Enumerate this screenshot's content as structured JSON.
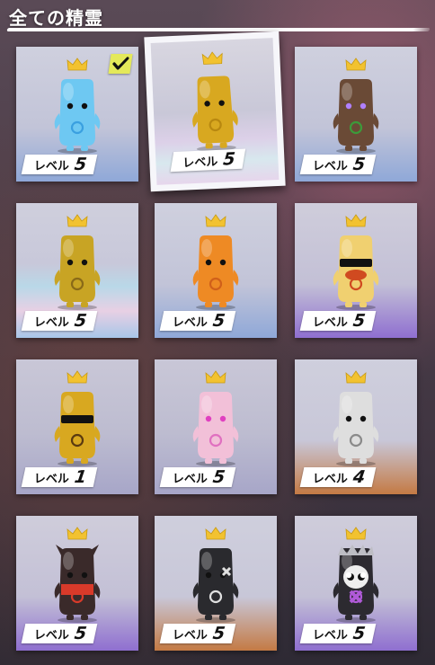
{
  "header": {
    "title": "全ての精霊"
  },
  "level_label": "レベル",
  "spirits": [
    {
      "level": "5",
      "body": "#6ec8f2",
      "accent": "#3aa0e0",
      "bg": "blue",
      "owned": true,
      "selected": false
    },
    {
      "level": "5",
      "body": "#d8a820",
      "accent": "#b88810",
      "bg": "rainbow",
      "owned": false,
      "selected": true
    },
    {
      "level": "5",
      "body": "#6a4a36",
      "accent": "#3c9a3a",
      "bg": "blue",
      "owned": false,
      "selected": false
    },
    {
      "level": "5",
      "body": "#c8a424",
      "accent": "#8a6a18",
      "bg": "rainbow",
      "owned": false,
      "selected": false
    },
    {
      "level": "5",
      "body": "#ee8a24",
      "accent": "#d0601a",
      "bg": "blue",
      "owned": false,
      "selected": false
    },
    {
      "level": "5",
      "body": "#f0d070",
      "accent": "#d04a20",
      "bg": "purple",
      "owned": false,
      "selected": false
    },
    {
      "level": "1",
      "body": "#d8a820",
      "accent": "#5a3a10",
      "bg": "plain",
      "owned": false,
      "selected": false
    },
    {
      "level": "5",
      "body": "#f2c0d8",
      "accent": "#e070c0",
      "bg": "plain",
      "owned": false,
      "selected": false
    },
    {
      "level": "4",
      "body": "#dedede",
      "accent": "#8a8a8a",
      "bg": "orange",
      "owned": false,
      "selected": false
    },
    {
      "level": "5",
      "body": "#3a2a2a",
      "accent": "#d83a2a",
      "bg": "purple",
      "owned": false,
      "selected": false
    },
    {
      "level": "5",
      "body": "#2a2a2e",
      "accent": "#e0e0e0",
      "bg": "orange",
      "owned": false,
      "selected": false
    },
    {
      "level": "5",
      "body": "#2c2a30",
      "accent": "#b05ad8",
      "bg": "purple",
      "owned": false,
      "selected": false
    }
  ],
  "colors": {
    "crown": "#f2c230",
    "check": "#e4e95a"
  }
}
